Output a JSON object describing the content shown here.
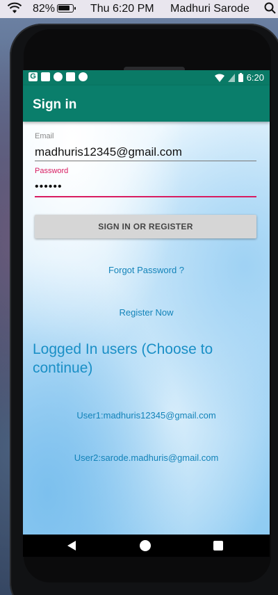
{
  "menubar": {
    "battery_percent": "82%",
    "clock": "Thu 6:20 PM",
    "user_name": "Madhuri Sarode"
  },
  "status_bar": {
    "time": "6:20",
    "icons_left": [
      "google-icon",
      "photos-icon",
      "play-icon",
      "sd-card-icon",
      "sync-icon"
    ],
    "icons_right": [
      "wifi-icon",
      "signal-icon",
      "battery-icon"
    ]
  },
  "app_bar": {
    "title": "Sign in"
  },
  "form": {
    "email_label": "Email",
    "email_value": "madhuris12345@gmail.com",
    "password_label": "Password",
    "password_value": "••••••",
    "submit_label": "SIGN IN OR REGISTER"
  },
  "links": {
    "forgot_password": "Forgot Password ?",
    "register_now": "Register Now"
  },
  "logged_in": {
    "heading": "Logged In users (Choose to continue)",
    "users": [
      "User1:madhuris12345@gmail.com",
      "User2:sarode.madhuris@gmail.com"
    ]
  },
  "colors": {
    "app_bar": "#0a7e6b",
    "accent": "#d81b60",
    "link": "#1383b9"
  }
}
